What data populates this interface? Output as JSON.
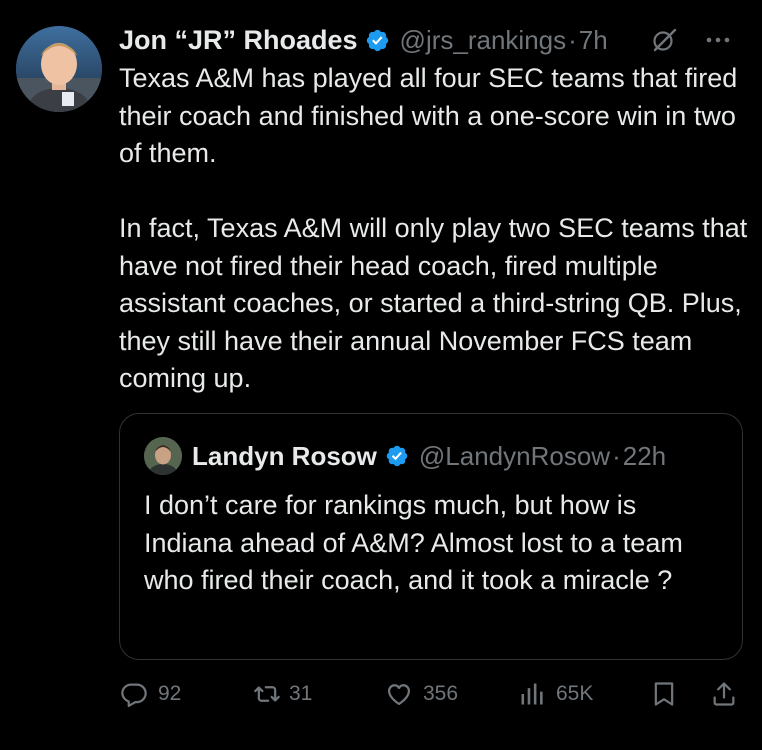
{
  "author": {
    "name": "Jon “JR” Rhoades",
    "handle": "@jrs_rankings",
    "separator": "·",
    "time": "7h"
  },
  "tweet": {
    "text": "Texas A&M has played all four SEC teams that fired their coach and finished with a one-score win in two of them.\n\nIn fact, Texas A&M will only play two SEC teams that have not fired their head coach, fired multiple assistant coaches, or started a third-string QB. Plus, they still have their annual November FCS team coming up."
  },
  "quote": {
    "name": "Landyn Rosow",
    "handle": "@LandynRosow",
    "separator": "·",
    "time": "22h",
    "text": "I don’t care for rankings much, but how is Indiana ahead of A&M? Almost lost to a team who fired their coach, and it took a miracle ?"
  },
  "actions": {
    "replies": "92",
    "retweets": "31",
    "likes": "356",
    "views": "65K"
  },
  "colors": {
    "background": "#000000",
    "text": "#e7e9ea",
    "muted": "#71767b",
    "verified": "#1d9bf0",
    "border": "#2f3336"
  },
  "icons": [
    "verified-badge-icon",
    "grok-icon",
    "more-icon",
    "reply-icon",
    "retweet-icon",
    "like-icon",
    "views-icon",
    "bookmark-icon",
    "share-icon"
  ]
}
